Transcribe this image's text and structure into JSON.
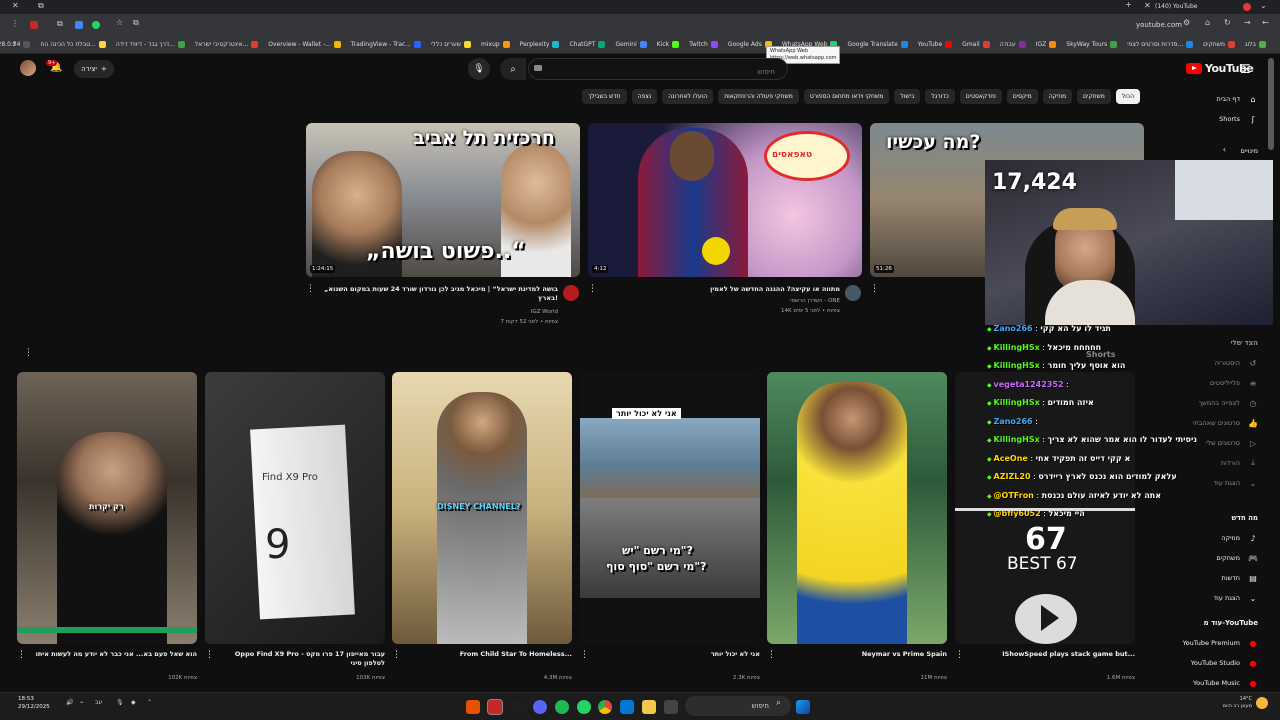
{
  "browser": {
    "tab_title": "(140) YouTube",
    "address": "youtube.com",
    "bookmarks": [
      {
        "label": "בלוג",
        "color": "#4caf50"
      },
      {
        "label": "משחקים",
        "color": "#e53935"
      },
      {
        "label": "סדרות וסרטים לצפי...",
        "color": "#1e88e5"
      },
      {
        "label": "SkyWay Tours",
        "color": "#43a047"
      },
      {
        "label": "IGZ",
        "color": "#fb8c00"
      },
      {
        "label": "עבודה",
        "color": "#8e24aa"
      },
      {
        "label": "Gmail",
        "color": "#e53935"
      },
      {
        "label": "YouTube",
        "color": "#ff0000"
      },
      {
        "label": "Google Translate",
        "color": "#1e88e5"
      },
      {
        "label": "WhatsApp Web",
        "color": "#25d366"
      },
      {
        "label": "Google Ads",
        "color": "#fbbc04"
      },
      {
        "label": "Twitch",
        "color": "#9146ff"
      },
      {
        "label": "Kick",
        "color": "#53fc18"
      },
      {
        "label": "Gemini",
        "color": "#4285f4"
      },
      {
        "label": "ChatGPT",
        "color": "#10a37f"
      },
      {
        "label": "Perplexity",
        "color": "#20b8cd"
      },
      {
        "label": "mixup",
        "color": "#ff9800"
      },
      {
        "label": "שערים כללי",
        "color": "#fdd835"
      },
      {
        "label": "TradingView - Trac...",
        "color": "#2962ff"
      },
      {
        "label": "Overview - Wallet -...",
        "color": "#f4b400"
      },
      {
        "label": "אינטרקטיבי ישראל...",
        "color": "#e53935"
      },
      {
        "label": "דרך גבר - דיוויד דידה...",
        "color": "#43a047"
      },
      {
        "label": "טבלת כל הכינה הח...",
        "color": "#fdd835"
      },
      {
        "label": "Paletools v28.0.24",
        "color": "#555555"
      }
    ],
    "tooltip_title": "WhatsApp Web",
    "tooltip_url": "https://web.whatsapp.com"
  },
  "youtube": {
    "logo": "YouTube",
    "search_placeholder": "חיפוש",
    "create_label": "יצירה",
    "notif_count": "9+",
    "chips": [
      {
        "label": "הכול",
        "active": true
      },
      {
        "label": "משחקים"
      },
      {
        "label": "מוזיקה"
      },
      {
        "label": "מיקסים"
      },
      {
        "label": "פודקאסטים"
      },
      {
        "label": "כדורגל"
      },
      {
        "label": "בישול"
      },
      {
        "label": "משחקי וידאו מתחום הספורט"
      },
      {
        "label": "משחקי פעולה והרפתקאות"
      },
      {
        "label": "הועלו לאחרונה"
      },
      {
        "label": "נצפה"
      },
      {
        "label": "חדש בשבילך"
      }
    ],
    "sidebar": {
      "home": "דף הבית",
      "shorts": "Shorts",
      "subscriptions": "מינויים",
      "you_header": "הצד שלי",
      "you_items": [
        "היסטוריה",
        "פלייליסטים",
        "לצפייה בהמשך",
        "סרטונים שאהבתי",
        "סרטונים שלי",
        "הורדות",
        "הצגת עוד"
      ],
      "explore_header": "מה חדש",
      "explore_items": [
        "מוזיקה",
        "משחקים",
        "חדשות",
        "הצגת עוד"
      ],
      "more_header": "עוד מ-YouTube",
      "more_items": [
        "YouTube Premium",
        "YouTube Studio",
        "YouTube Music"
      ]
    },
    "shorts_shelf_label": "Shorts",
    "videos": [
      {
        "thumb_text_top": "חרכזית תל אביב",
        "thumb_text_bottom": "„פשוט בושה..“",
        "duration": "1:24:15",
        "title": "„בושה למדינת ישראל“ | מיכאל מגיב לכן גורדון שורד 24 שעות במקום השנוא בארץ!",
        "channel": "IGZ World",
        "meta": "7 צפיות • לפני 52 דקות"
      },
      {
        "thumb_text_top": "טאפאסים",
        "duration": "4:12",
        "title": "מתווה או עקיצה? ההגנה החדשה של לאמין",
        "channel": "השדרן הרשמי - ONE",
        "meta": "14K צפיות • לפני 5 ימים"
      },
      {
        "thumb_text_top": "מה עכשיו?",
        "duration": "51:26",
        "title": "",
        "channel": "",
        "meta": ""
      }
    ],
    "shorts": [
      {
        "overlay": "רק יקרות",
        "title": "הוא שאל פעם בא... אני כבר לא יודע מה לעשות איתו",
        "views": "102K צפיות"
      },
      {
        "overlay": "Find X9 Pro",
        "title": "Oppo Find X9 Pro - עבור מאייפון 17 פרו מקס לטלפון סיני",
        "views": "103K צפיות"
      },
      {
        "overlay": "DISNEY CHANNEL?",
        "title": "From Child Star To Homeless...",
        "views": "4.3M צפיות"
      },
      {
        "overlay": "אני לא יכול יותר",
        "overlay2": "מי רשם \"יש\"?",
        "overlay3": "מי רשם \"סוף סוף\"?",
        "title": "אני לא יכול יותר",
        "views": "2.3K צפיות"
      },
      {
        "overlay": "",
        "title": "Neymar vs Prime Spain",
        "views": "11M צפיות"
      },
      {
        "overlay": "67",
        "overlay2": "BEST 67",
        "title": "IShowSpeed plays stack game but...",
        "views": "1.6M צפיות"
      }
    ]
  },
  "stream": {
    "viewers": "17,424",
    "chat": [
      {
        "user": "Zano266",
        "msg": "תגיד לו על הא קקי",
        "color": "#3fa9f5"
      },
      {
        "user": "KillingHSx",
        "msg": "חחחחח מיכאל",
        "color": "#53fc18"
      },
      {
        "user": "KillingHSx",
        "msg": "הוא אוסף עליך חומר",
        "color": "#53fc18"
      },
      {
        "user": "vegeta1242352",
        "msg": "",
        "color": "#c6f"
      },
      {
        "user": "KillingHSx",
        "msg": "איזה חמודים",
        "color": "#53fc18"
      },
      {
        "user": "Zano266",
        "msg": "",
        "color": "#3fa9f5"
      },
      {
        "user": "KillingHSx",
        "msg": "ניסיתי לעדור לו הוא אמר שהוא לא צריך",
        "color": "#53fc18"
      },
      {
        "user": "AceOne",
        "msg": "א קקי דייס זה תפקיד אחי",
        "color": "#ffd700"
      },
      {
        "user": "AZIZL20",
        "msg": "עלאק למודים הוא נכנס לארץ ריידרס",
        "color": "#ffd700"
      },
      {
        "user": "@OTFron",
        "msg": "אתה לא יודע לאיזה עולם נכנסת",
        "color": "#ffd700"
      },
      {
        "user": "@bfly6052",
        "msg": "היי מיכאל",
        "color": "#ffd700"
      }
    ]
  },
  "taskbar": {
    "search_label": "חיפוש",
    "time": "18:53",
    "date": "29/12/2025",
    "lang": "עב",
    "weather_temp": "14°C",
    "weather_desc": "מעונן רב היום"
  }
}
